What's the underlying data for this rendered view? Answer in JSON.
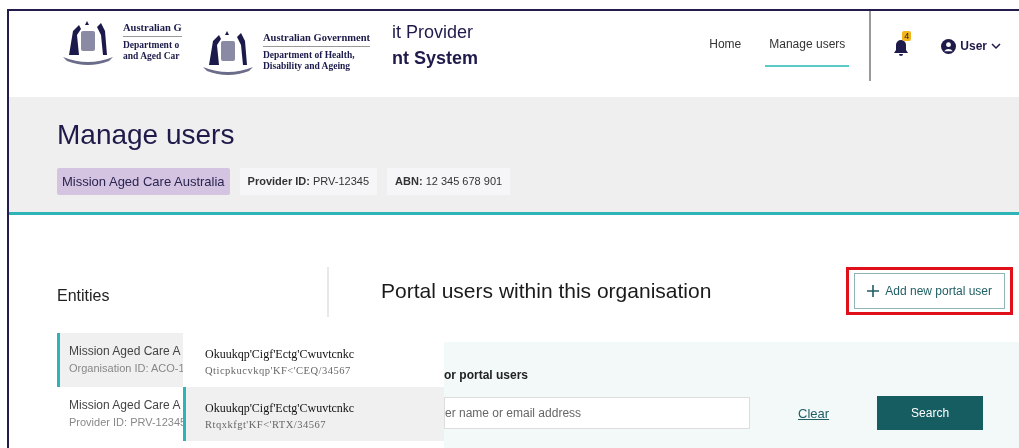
{
  "header": {
    "logo": {
      "name": "Australian G",
      "department": [
        "Department o",
        "and Aged Car"
      ]
    },
    "logo_overlay": {
      "name": "Australian Government",
      "department": [
        "Department of Health,",
        "Disability and Ageing"
      ]
    },
    "title": [
      "it Provider",
      "nt System"
    ],
    "nav": [
      {
        "label": "Home",
        "selected": false
      },
      {
        "label": "Manage users",
        "selected": true
      }
    ],
    "notifications": {
      "count": "4"
    },
    "user": {
      "label": "User"
    }
  },
  "page": {
    "title": "Manage users",
    "organisation": "Mission Aged Care Australia",
    "details": [
      {
        "label": "Provider ID:",
        "value": "PRV-12345"
      },
      {
        "label": "ABN:",
        "value": "12 345 678 901"
      }
    ]
  },
  "entities": {
    "title": "Entities",
    "items": [
      {
        "name": "Mission Aged Care A",
        "id": "Organisation ID: ACO-1",
        "selected": true
      },
      {
        "name": "Mission Aged Care A",
        "id": "Provider ID: PRV-12345",
        "selected": false
      }
    ]
  },
  "popup": {
    "items": [
      {
        "name": "Okuukqp'Cigf'Ectg'Cwuvtcnkc",
        "id": "Qticpkucvkqp'KF<'CEQ/34567",
        "selected": false
      },
      {
        "name": "Okuukqp'Cigf'Ectg'Cwuvtcnkc",
        "id": "Rtqxkfgt'KF<'RTX/34567",
        "selected": true
      }
    ]
  },
  "main": {
    "title": "Portal users within this organisation",
    "add_button": "Add new portal user",
    "add_button_highlighted": true,
    "search": {
      "label": "or portal users",
      "placeholder": "er name or email address",
      "clear": "Clear",
      "button": "Search"
    }
  }
}
